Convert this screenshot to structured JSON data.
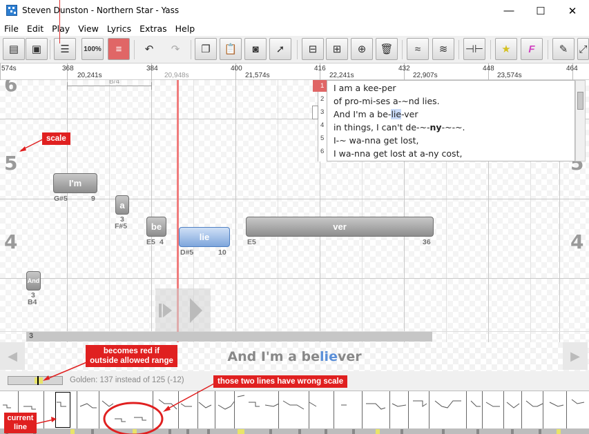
{
  "window": {
    "title": "Steven Dunston - Northern Star - Yass",
    "minimize": "—",
    "maximize": "☐",
    "close": "✕"
  },
  "menu": [
    "File",
    "Edit",
    "Play",
    "View",
    "Lyrics",
    "Extras",
    "Help"
  ],
  "toolbar": {
    "zoom_label": "100%",
    "icons": [
      "notebook-icon",
      "save-icon",
      "list-icon",
      "zoom-icon",
      "golden-toggle-icon",
      "undo-icon",
      "redo-icon",
      "copy-icon",
      "paste-icon",
      "camera-icon",
      "select-icon",
      "split-icon",
      "join-icon",
      "add-note-icon",
      "delete-icon",
      "rap-icon",
      "freestyle-icon",
      "pagebreak-icon",
      "golden-icon",
      "freestyle-f-icon",
      "edit-icon",
      "fullscreen-icon"
    ]
  },
  "ruler": {
    "beats": [
      "574s",
      "368",
      "384",
      "400",
      "416",
      "432",
      "448",
      "464"
    ],
    "times": [
      "20,241s",
      "20,948s",
      "21,574s",
      "22,241s",
      "22,907s",
      "23,574s"
    ]
  },
  "sheet": {
    "octaves": [
      "6",
      "5",
      "4"
    ],
    "bracket_label": "B/4",
    "notes": [
      {
        "text": "I'm",
        "pitch": "G#5",
        "length": "9"
      },
      {
        "text": "a",
        "pitch": "F#5",
        "length": "3"
      },
      {
        "text": "be",
        "pitch": "E5",
        "length": "4"
      },
      {
        "text": "lie",
        "pitch": "D#5",
        "length": "10"
      },
      {
        "text": "ver",
        "pitch": "E5",
        "length": "36"
      },
      {
        "text": "And",
        "pitch": "B4",
        "length": "3"
      }
    ]
  },
  "lyrics": {
    "line_numbers": [
      "1",
      "2",
      "3",
      "4",
      "5",
      "6"
    ],
    "lines": [
      "I am a kee-per",
      "of pro-mi-ses a-~nd lies.",
      "And I'm a be-lie-ver",
      "in things, I can't de-~-ny-~-~.",
      "I-~ wa-nna get lost,",
      "I wa-nna get lost at a-ny cost,"
    ],
    "line3_before": "And I'm a be-",
    "line3_hl": "lie",
    "line3_after": "-ver",
    "line4_before": "in things, I can't de-~-",
    "line4_bold": "ny",
    "line4_after": "-~-~."
  },
  "linebar_label": "3",
  "current_lyric": {
    "before": "And I'm a be",
    "current": "lie",
    "after": "ver"
  },
  "status": {
    "golden": "Golden: 137 instead of 125 (-12)"
  },
  "annotations": {
    "scale": "scale",
    "becomes_red": "becomes red if outside allowed range",
    "wrong_scale": "those two lines have wrong scale",
    "current_line": "current line"
  },
  "colors": {
    "annotation": "#e02020",
    "cursor": "#f07c7c",
    "selected_note": "#7ea6dc",
    "golden": "#e8e46a"
  }
}
